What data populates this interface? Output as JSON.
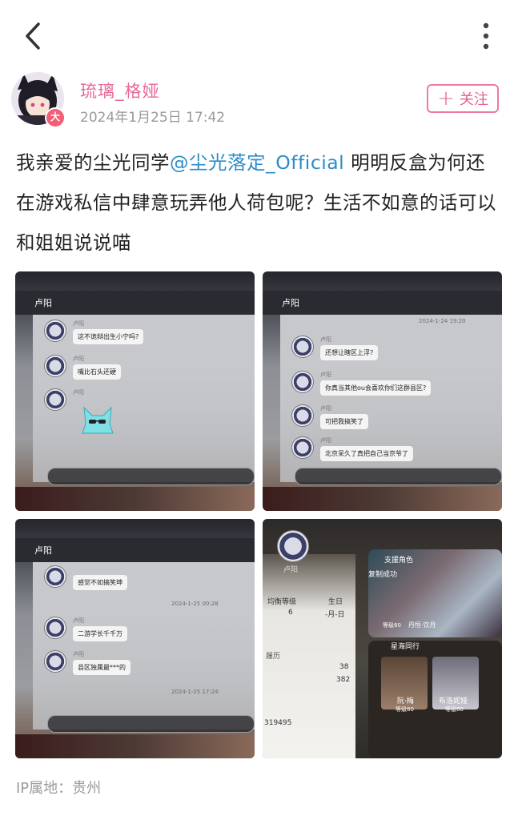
{
  "header": {
    "back_icon": "chevron-left-icon",
    "more_icon": "more-vertical-icon"
  },
  "author": {
    "name": "琉璃_格娅",
    "posted_at": "2024年1月25日 17:42",
    "badge": "大",
    "follow_label": "关注",
    "follow_icon": "plus-icon"
  },
  "post": {
    "text_before": "我亲爱的尘光同学",
    "mention": "@尘光落定_Official",
    "text_after": " 明明反盒为何还在游戏私信中肆意玩弄他人荷包呢？生活不如意的话可以和姐姐说说喵"
  },
  "images": [
    {
      "chat_title": "卢阳",
      "messages": [
        {
          "name": "卢阳",
          "text": "这不诡辩出生小宁吗?"
        },
        {
          "name": "卢阳",
          "text": "嘴比石头还硬"
        },
        {
          "name": "卢阳",
          "text": ""
        }
      ]
    },
    {
      "chat_title": "卢阳",
      "timestamp": "2024-1-24 19:20",
      "messages": [
        {
          "name": "卢阳",
          "text": "还想让瞎区上浮?"
        },
        {
          "name": "卢阳",
          "text": "你真当其他ou会喜欢你们这群县区?"
        },
        {
          "name": "卢阳",
          "text": "可把我搞笑了"
        },
        {
          "name": "卢阳",
          "text": "北京呆久了真把自己当京爷了"
        }
      ]
    },
    {
      "chat_title": "卢阳",
      "messages": [
        {
          "name": "",
          "text": "感觉不如搞笑坤"
        },
        {
          "name": "卢阳",
          "text": "二游学长千千万"
        },
        {
          "name": "卢阳",
          "text": "县区独属最***的"
        }
      ],
      "timestamps": [
        "2024-1-25 00:28",
        "2024-1-25 17:24"
      ]
    },
    {
      "player_name": "卢阳",
      "level_label": "均衡等级",
      "level_value": "6",
      "birthday_label": "生日",
      "birthday_value": "-月-日",
      "copy_toast": "复制成功",
      "support_label": "支援角色",
      "support_level": "等级80",
      "support_name": "丹恒·饮月",
      "companions_label": "星海同行",
      "companions": [
        {
          "name": "阮·梅",
          "level": "等级80"
        },
        {
          "name": "布洛妮娅",
          "level": "等级80"
        }
      ],
      "history_label": "履历",
      "stats": [
        "38",
        "382"
      ],
      "uid_partial": "319495"
    }
  ],
  "footer": {
    "ip_location": "IP属地：贵州"
  }
}
